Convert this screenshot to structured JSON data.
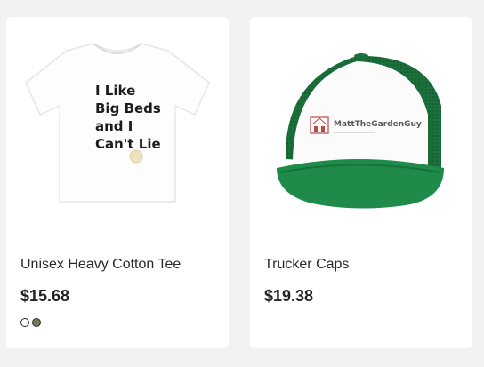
{
  "products": [
    {
      "title": "Unisex Heavy Cotton Tee",
      "price": "$15.68",
      "image_text": [
        "I Like",
        "Big Beds",
        "and I",
        "Can't Lie"
      ],
      "swatches": [
        "#ffffff",
        "#747a5c"
      ]
    },
    {
      "title": "Trucker Caps",
      "price": "$19.38",
      "image_text": [
        "MattTheGardenGuy"
      ]
    }
  ],
  "colors": {
    "background": "#f2f2f2",
    "card": "#ffffff",
    "cap_green": "#1f8a4a",
    "cap_mesh": "#1a6f3b"
  },
  "icons": [
    "t-shirt-product-image",
    "trucker-cap-product-image",
    "color-swatch"
  ]
}
